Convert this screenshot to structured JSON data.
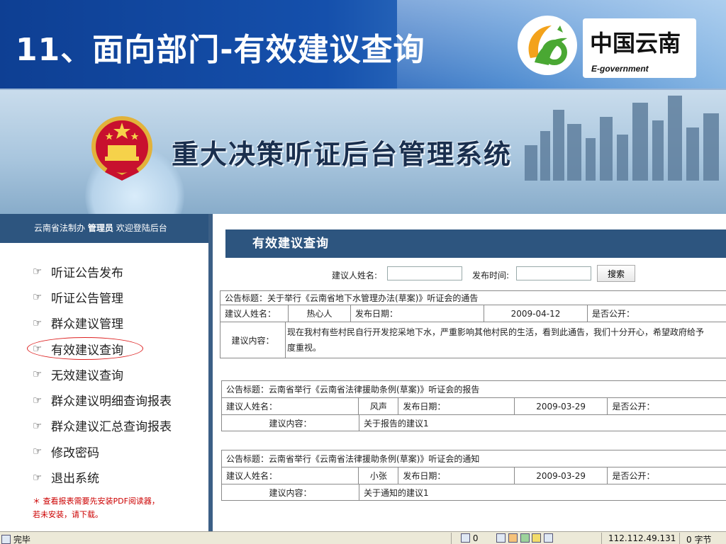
{
  "slide": {
    "title": "11、面向部门-有效建议查询",
    "logo_cn": "中国云南",
    "logo_en": "E-government"
  },
  "app": {
    "banner_title": "重大决策听证后台管理系统"
  },
  "sidebar": {
    "welcome_org": "云南省法制办",
    "welcome_role": "管理员",
    "welcome_text": "欢迎登陆后台",
    "items": [
      {
        "label": "听证公告发布"
      },
      {
        "label": "听证公告管理"
      },
      {
        "label": "群众建议管理"
      },
      {
        "label": "有效建议查询"
      },
      {
        "label": "无效建议查询"
      },
      {
        "label": "群众建议明细查询报表"
      },
      {
        "label": "群众建议汇总查询报表"
      },
      {
        "label": "修改密码"
      },
      {
        "label": "退出系统"
      }
    ],
    "active_index": 3,
    "note_line1": "＊ 查看报表需要先安装PDF阅读器，",
    "note_line2": "若未安装，请下载。"
  },
  "main": {
    "heading": "有效建议查询",
    "search": {
      "name_label": "建议人姓名:",
      "name_value": "",
      "date_label": "发布时间:",
      "date_value": "",
      "button_label": "搜索"
    },
    "records": [
      {
        "title_label": "公告标题：",
        "title": "关于举行《云南省地下水管理办法(草案)》听证会的通告",
        "name_label": "建议人姓名：",
        "name": "热心人",
        "date_label": "发布日期：",
        "date": "2009-04-12",
        "public_label": "是否公开：",
        "content_label": "建议内容：",
        "content_line1": "现在我村有些村民自行开发挖采地下水，严重影响其他村民的生活，看到此通告，我们十分开心，希望政府给予",
        "content_line2": "度重视。"
      },
      {
        "title_label": "公告标题：",
        "title": "云南省举行《云南省法律援助条例(草案)》听证会的报告",
        "name_label": "建议人姓名：",
        "name": "风声",
        "date_label": "发布日期：",
        "date": "2009-03-29",
        "public_label": "是否公开：",
        "content_label": "建议内容：",
        "content_line1": "关于报告的建议1"
      },
      {
        "title_label": "公告标题：",
        "title": "云南省举行《云南省法律援助条例(草案)》听证会的通知",
        "name_label": "建议人姓名：",
        "name": "小张",
        "date_label": "发布日期：",
        "date": "2009-03-29",
        "public_label": "是否公开：",
        "content_label": "建议内容：",
        "content_line1": "关于通知的建议1"
      }
    ]
  },
  "statusbar": {
    "status": "完毕",
    "count": "0",
    "ip": "112.112.49.131",
    "bytes": "0 字节"
  }
}
